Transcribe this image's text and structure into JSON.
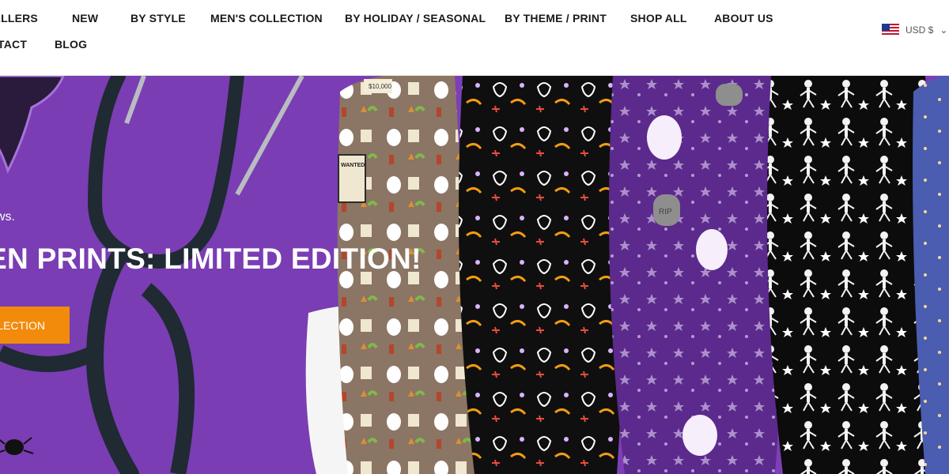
{
  "nav": {
    "row1": [
      {
        "label": "SELLERS"
      },
      {
        "label": "NEW"
      },
      {
        "label": "BY STYLE"
      },
      {
        "label": "MEN'S COLLECTION"
      },
      {
        "label": "BY HOLIDAY / SEASONAL"
      },
      {
        "label": "BY THEME / PRINT"
      },
      {
        "label": "SHOP ALL"
      },
      {
        "label": "ABOUT US"
      }
    ],
    "row2": [
      {
        "label": "TACT"
      },
      {
        "label": "BLOG"
      }
    ]
  },
  "currency": {
    "flag_icon": "us-flag-icon",
    "label": "USD $",
    "chevron_icon": "chevron-down-icon"
  },
  "hero": {
    "background_color": "#7d3fb6",
    "kicker": "ews.",
    "headline": "EN PRINTS: LIMITED EDITION!",
    "cta_label": "LECTION",
    "cta_color": "#f28b0c",
    "image_labels": [
      "$10,000",
      "WANTED",
      "RIP"
    ]
  }
}
